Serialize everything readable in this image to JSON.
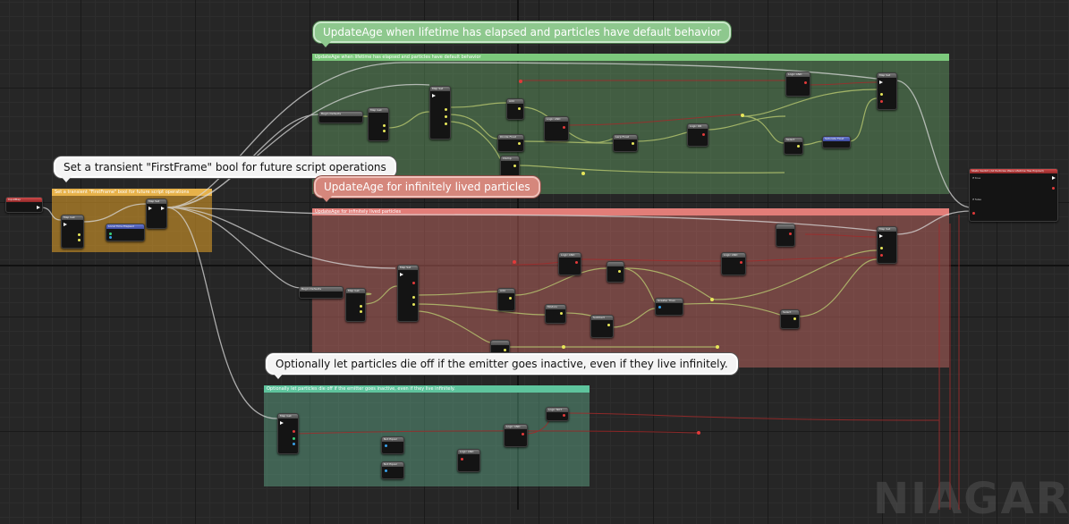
{
  "comments": {
    "main_green": "UpdateAge when lifetime has elapsed and particles have default behavior",
    "main_red": "UpdateAge for infinitely lived particles",
    "main_orange": "Set a transient \"FirstFrame\" bool for future script operations",
    "main_teal": "Optionally let particles die off if the emitter goes inactive, even if they live infinitely."
  },
  "nodes": {
    "input_map": "InputMap",
    "map_get_orange": "Map Get",
    "map_set_orange": "Map Set",
    "local_time_elapsed": "Local Time Elapsed",
    "begin_defaults_green": "Begin Defaults",
    "map_get_green": "Map Get",
    "map_set_green": "Map Set",
    "add": "Add",
    "logic_and_green": "Logic AND",
    "divide_float": "Divide Float",
    "clamp": "Clamp",
    "lerp_float": "Lerp Float",
    "logic_or": "Logic OR",
    "logic_and_top": "Logic AND",
    "map_set_top_green": "Map Set",
    "select": "Select",
    "saturate_float": "Saturate Float",
    "static_switch": "Static Switch (All Particles Were Lifetime Has Expired)",
    "static_switch_pin_true": "If true",
    "static_switch_pin_false": "If false",
    "begin_defaults_red": "Begin Defaults",
    "map_get_red": "Map Get",
    "map_set_red": "Map Set",
    "add_red": "Add",
    "logic_and_red": "Logic AND",
    "modulo": "Modulo",
    "subtract": "Subtract",
    "greater_than": "Greater Than",
    "logic_and_red_right": "Logic AND",
    "select_red": "Select",
    "map_set_right_red": "Map Set",
    "map_get_teal": "Map Get",
    "not_equal_1": "Not Equal",
    "not_equal_2": "Not Equal",
    "logic_and_teal": "Logic AND",
    "logic_and_teal2": "Logic AND",
    "logic_not": "Logic NOT"
  },
  "watermark": "NIAGARA",
  "colors": {
    "green_comment": "#7cc97c",
    "red_comment": "#e27d78",
    "teal_comment": "#5ec49d",
    "orange_comment": "#e7b24a"
  }
}
